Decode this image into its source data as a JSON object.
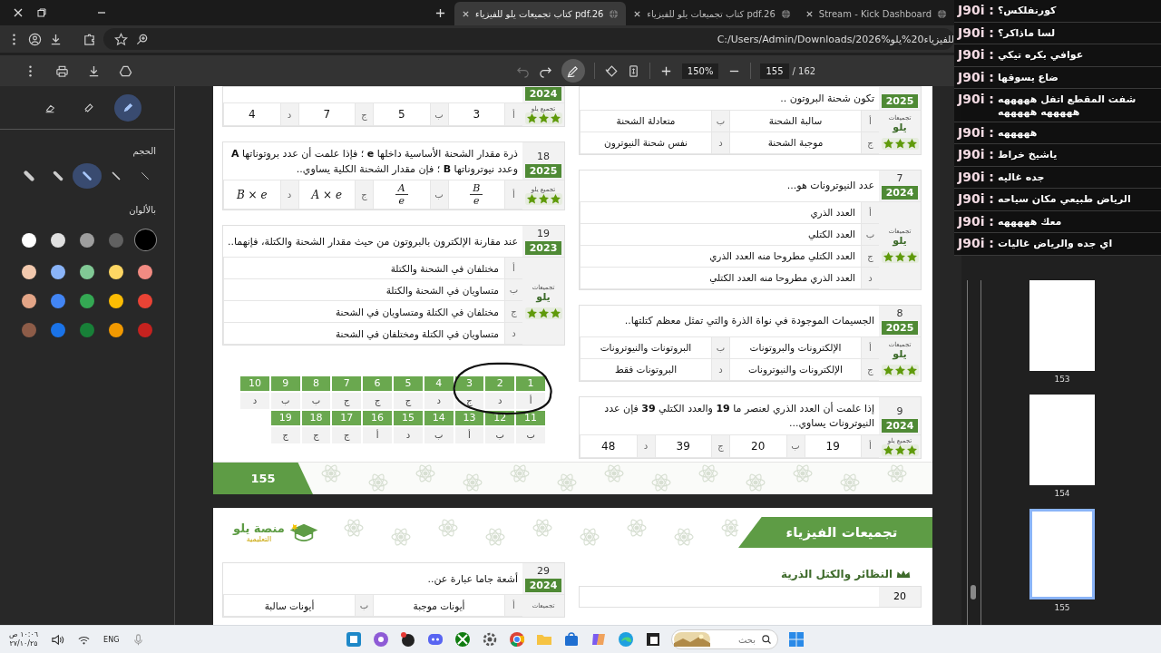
{
  "browser": {
    "tabs": [
      {
        "title": "Stream - Kick Dashboard",
        "selected": false
      },
      {
        "title": "كتاب تجميعات يلو للفيزياء pdf.26",
        "selected": false
      },
      {
        "title": "كتاب تجميعات يلو للفيزياء pdf.26",
        "selected": true
      }
    ],
    "address": "C:/Users/Admin/Downloads/2026%للفيزياء20%يلو"
  },
  "pdf_toolbar": {
    "zoom": "150%",
    "page": "155",
    "page_total": "/ 162"
  },
  "annotation_panel": {
    "tools": [
      {
        "kind": "pen",
        "selected": true
      },
      {
        "kind": "highlighter",
        "selected": false
      },
      {
        "kind": "eraser",
        "selected": false
      }
    ],
    "size_label": "الحجم",
    "sizes": [
      {
        "selected": false
      },
      {
        "selected": false
      },
      {
        "selected": true
      },
      {
        "selected": false
      },
      {
        "selected": false
      }
    ],
    "colors_label": "بالألوان",
    "colors": [
      {
        "color": "#000000",
        "selected": true
      },
      {
        "color": "#616161",
        "selected": false
      },
      {
        "color": "#9e9e9e",
        "selected": false
      },
      {
        "color": "#e0e0e0",
        "selected": false
      },
      {
        "color": "#ffffff",
        "selected": false
      },
      {
        "color": "#f28b82",
        "selected": false
      },
      {
        "color": "#fdd663",
        "selected": false
      },
      {
        "color": "#81c995",
        "selected": false
      },
      {
        "color": "#8ab4f8",
        "selected": false
      },
      {
        "color": "#f2c9ae",
        "selected": false
      },
      {
        "color": "#ea4335",
        "selected": false
      },
      {
        "color": "#fbbc04",
        "selected": false
      },
      {
        "color": "#34a853",
        "selected": false
      },
      {
        "color": "#4285f4",
        "selected": false
      },
      {
        "color": "#e3a587",
        "selected": false
      },
      {
        "color": "#c5221f",
        "selected": false
      },
      {
        "color": "#f29900",
        "selected": false
      },
      {
        "color": "#188038",
        "selected": false
      },
      {
        "color": "#1a73e8",
        "selected": false
      },
      {
        "color": "#8d5c48",
        "selected": false
      }
    ]
  },
  "page": {
    "right_column": [
      {
        "year": "2025",
        "text": "تكون شحنة البروتون ..",
        "kind": "grid",
        "badge": {
          "label": "تجميعات",
          "brand": "يلو",
          "stars": 3
        },
        "options": [
          {
            "letter": "أ",
            "kind": "text",
            "text": "سالبة الشحنة"
          },
          {
            "letter": "ب",
            "kind": "text",
            "text": "متعادلة الشحنة"
          },
          {
            "letter": "ج",
            "kind": "text",
            "text": "موجبة الشحنة"
          },
          {
            "letter": "د",
            "kind": "text",
            "text": "نفس شحنة النيوترون"
          }
        ]
      },
      {
        "number": "7",
        "year": "2024",
        "text": "عدد النيوترونات هو...",
        "kind": "list",
        "badge": {
          "label": "تجميعات",
          "brand": "يلو",
          "stars": 3
        },
        "options": [
          {
            "letter": "أ",
            "kind": "text",
            "text": "العدد الذري"
          },
          {
            "letter": "ب",
            "kind": "text",
            "text": "العدد الكتلي"
          },
          {
            "letter": "ج",
            "kind": "text",
            "text": "العدد الكتلي مطروحا منه العدد الذري"
          },
          {
            "letter": "د",
            "kind": "text",
            "text": "العدد الذري مطروحا منه العدد الكتلي"
          }
        ]
      },
      {
        "number": "8",
        "year": "2025",
        "text": "الجسيمات الموجودة في نواة الذرة والتي تمثل معظم كتلتها..",
        "kind": "grid",
        "badge": {
          "label": "تجميعات",
          "brand": "يلو",
          "stars": 3
        },
        "options": [
          {
            "letter": "أ",
            "kind": "text",
            "text": "الإلكترونات والبروتونات"
          },
          {
            "letter": "ب",
            "kind": "text",
            "text": "البروتونات والنيوترونات"
          },
          {
            "letter": "ج",
            "kind": "text",
            "text": "الإلكترونات والنيوترونات"
          },
          {
            "letter": "د",
            "kind": "text",
            "text": "البروتونات فقط"
          }
        ]
      },
      {
        "number": "9",
        "year": "2024",
        "text": "إذا علمت أن العدد الذري لعنصر ما **19** والعدد الكتلي **39** فإن عدد النيوترونات يساوي...",
        "kind": "row",
        "badge": {
          "label": "تجميع يلو",
          "stars": 3
        },
        "options": [
          {
            "letter": "أ",
            "kind": "text",
            "text": "19"
          },
          {
            "letter": "ب",
            "kind": "text",
            "text": "20"
          },
          {
            "letter": "ج",
            "kind": "text",
            "text": "39"
          },
          {
            "letter": "د",
            "kind": "text",
            "text": "48"
          }
        ]
      }
    ],
    "left_column": [
      {
        "year": "2024",
        "kind": "row",
        "badge": {
          "label": "تجميع يلو",
          "stars": 3
        },
        "options": [
          {
            "letter": "أ",
            "kind": "text",
            "text": "3"
          },
          {
            "letter": "ب",
            "kind": "text",
            "text": "5"
          },
          {
            "letter": "ج",
            "kind": "text",
            "text": "7"
          },
          {
            "letter": "د",
            "kind": "text",
            "text": "4"
          }
        ]
      },
      {
        "number": "18",
        "year": "2025",
        "text": "ذرة مقدار الشحنة الأساسية داخلها **e** ؛ فإذا علمت أن عدد بروتوناتها **A** وعدد نيوتروناتها **B** ؛ فإن مقدار الشحنة الكلية يساوي..",
        "kind": "row",
        "badge": {
          "label": "تجميع يلو",
          "stars": 3
        },
        "options": [
          {
            "letter": "أ",
            "kind": "fraction",
            "numerator": "B",
            "denominator": "e"
          },
          {
            "letter": "ب",
            "kind": "fraction",
            "numerator": "A",
            "denominator": "e"
          },
          {
            "letter": "ج",
            "kind": "math",
            "text": "A × e"
          },
          {
            "letter": "د",
            "kind": "math",
            "text": "B × e"
          }
        ]
      },
      {
        "number": "19",
        "year": "2023",
        "text": "عند مقارنة الإلكترون بالبروتون من حيث مقدار الشحنة والكتلة، فإنهما..",
        "kind": "list",
        "badge": {
          "label": "تجميعات",
          "brand": "يلو",
          "stars": 3
        },
        "options": [
          {
            "letter": "أ",
            "kind": "text",
            "text": "مختلفان في الشحنة والكتلة"
          },
          {
            "letter": "ب",
            "kind": "text",
            "text": "متساويان في الشحنة والكتلة"
          },
          {
            "letter": "ج",
            "kind": "text",
            "text": "مختلفان في الكتلة ومتساويان في الشحنة"
          },
          {
            "letter": "د",
            "kind": "text",
            "text": "متساويان في الكتلة ومختلفان في الشحنة"
          }
        ]
      }
    ],
    "answer_key": [
      {
        "number": "1",
        "answer": "أ"
      },
      {
        "number": "2",
        "answer": "د"
      },
      {
        "number": "3",
        "answer": "ج"
      },
      {
        "number": "4",
        "answer": "د"
      },
      {
        "number": "5",
        "answer": "ج"
      },
      {
        "number": "6",
        "answer": "ج"
      },
      {
        "number": "7",
        "answer": "ج"
      },
      {
        "number": "8",
        "answer": "ب"
      },
      {
        "number": "9",
        "answer": "ب"
      },
      {
        "number": "10",
        "answer": "د"
      },
      {
        "number": "11",
        "answer": "ب"
      },
      {
        "number": "12",
        "answer": "ب"
      },
      {
        "number": "13",
        "answer": "أ"
      },
      {
        "number": "14",
        "answer": "ب"
      },
      {
        "number": "15",
        "answer": "د"
      },
      {
        "number": "16",
        "answer": "أ"
      },
      {
        "number": "17",
        "answer": "ج"
      },
      {
        "number": "18",
        "answer": "ج"
      },
      {
        "number": "19",
        "answer": "ج"
      }
    ],
    "page_number": "155"
  },
  "next_page": {
    "title": "تجميعات الفيزياء",
    "logo": {
      "name": "منصة يلو",
      "tagline": "التعليمية"
    },
    "section": "النظائر والكتل الذرية",
    "section_question_number": "20",
    "question": {
      "number": "29",
      "year": "2024",
      "text": "أشعة جاما عبارة عن..",
      "kind": "grid",
      "badge": {
        "label": "تجميعات"
      },
      "options": [
        {
          "letter": "أ",
          "kind": "text",
          "text": "أيونات موجبة"
        },
        {
          "letter": "ب",
          "kind": "text",
          "text": "أيونات سالبة"
        }
      ]
    }
  },
  "thumbnails": [
    {
      "label": "153",
      "selected": false
    },
    {
      "label": "154",
      "selected": false
    },
    {
      "label": "155",
      "selected": true
    }
  ],
  "chat": [
    {
      "user": "J90i :",
      "message": "كورنفلكس؟"
    },
    {
      "user": "J90i :",
      "message": "لسا ماذاكر؟"
    },
    {
      "user": "J90i :",
      "message": "عوافي بكره تيكي"
    },
    {
      "user": "J90i :",
      "message": "ضاع يسوقها"
    },
    {
      "user": "J90i :",
      "message": "شفت المقطع اتفل هههههه هههههه هههههه"
    },
    {
      "user": "J90i :",
      "message": "هههههه"
    },
    {
      "user": "J90i :",
      "message": "ياشيخ خراط"
    },
    {
      "user": "J90i :",
      "message": "جده غاليه"
    },
    {
      "user": "J90i :",
      "message": "الرياض طبيعي مكان سياحه"
    },
    {
      "user": "J90i :",
      "message": "معك هههههه"
    },
    {
      "user": "J90i :",
      "message": "اي جده والرياض غاليات"
    }
  ],
  "taskbar": {
    "search_placeholder": "بحث",
    "language": "ENG",
    "time": "١٠:٠٦ ص",
    "date": "٢٧/١٠/٢٥"
  }
}
